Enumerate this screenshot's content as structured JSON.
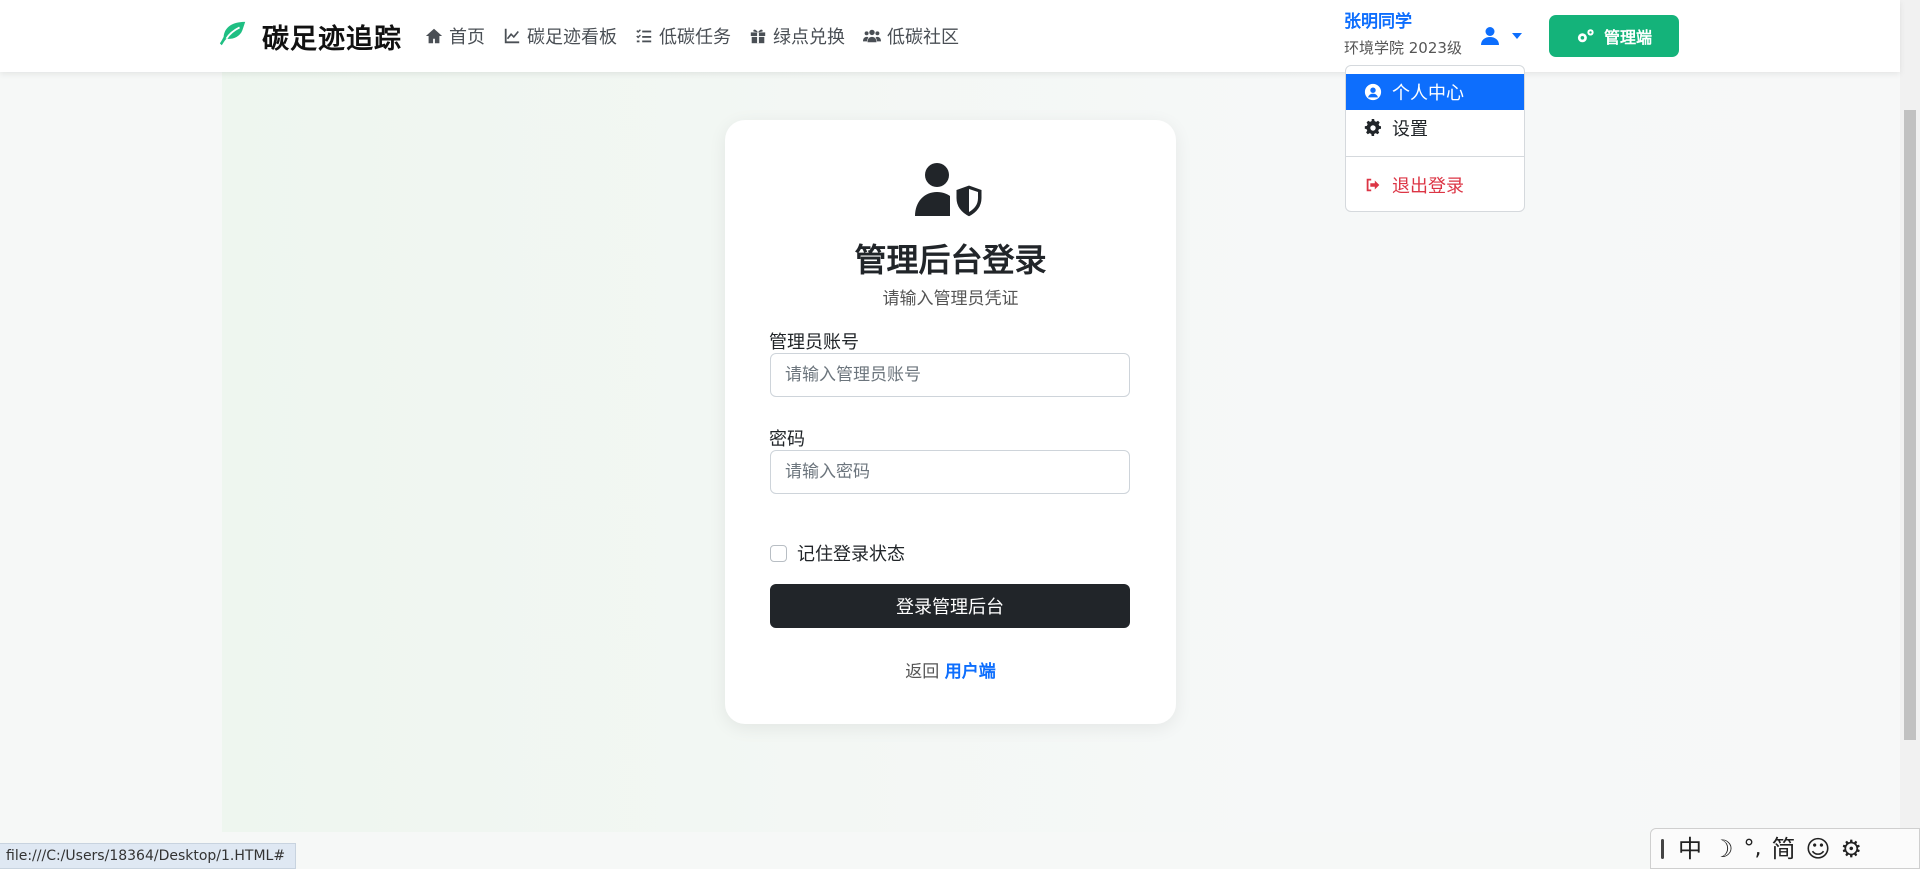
{
  "navbar": {
    "brand": "碳足迹追踪",
    "links": [
      {
        "label": "首页",
        "icon": "home-icon"
      },
      {
        "label": "碳足迹看板",
        "icon": "chart-line-icon"
      },
      {
        "label": "低碳任务",
        "icon": "task-list-icon"
      },
      {
        "label": "绿点兑换",
        "icon": "gift-icon"
      },
      {
        "label": "低碳社区",
        "icon": "users-icon"
      }
    ],
    "user": {
      "name": "张明同学",
      "meta": "环境学院 2023级"
    },
    "admin_button": "管理端"
  },
  "dropdown": {
    "items": [
      {
        "label": "个人中心",
        "icon": "user-circle-icon",
        "active": true
      },
      {
        "label": "设置",
        "icon": "gear-icon"
      },
      {
        "label": "退出登录",
        "icon": "sign-out-icon",
        "danger": true
      }
    ]
  },
  "login": {
    "title": "管理后台登录",
    "subtitle": "请输入管理员凭证",
    "account_label": "管理员账号",
    "account_placeholder": "请输入管理员账号",
    "password_label": "密码",
    "password_placeholder": "请输入密码",
    "remember_label": "记住登录状态",
    "submit_label": "登录管理后台",
    "back_prefix": "返回",
    "back_link": "用户端"
  },
  "status_bar": {
    "url": "file:///C:/Users/18364/Desktop/1.HTML#"
  },
  "ime": {
    "items": [
      "中",
      "☽",
      "°,",
      "简",
      "☺",
      "⚙"
    ]
  },
  "colors": {
    "brand_green": "#14b37a",
    "primary_blue": "#0d6efd",
    "danger_red": "#dc3545",
    "dark": "#212529"
  }
}
